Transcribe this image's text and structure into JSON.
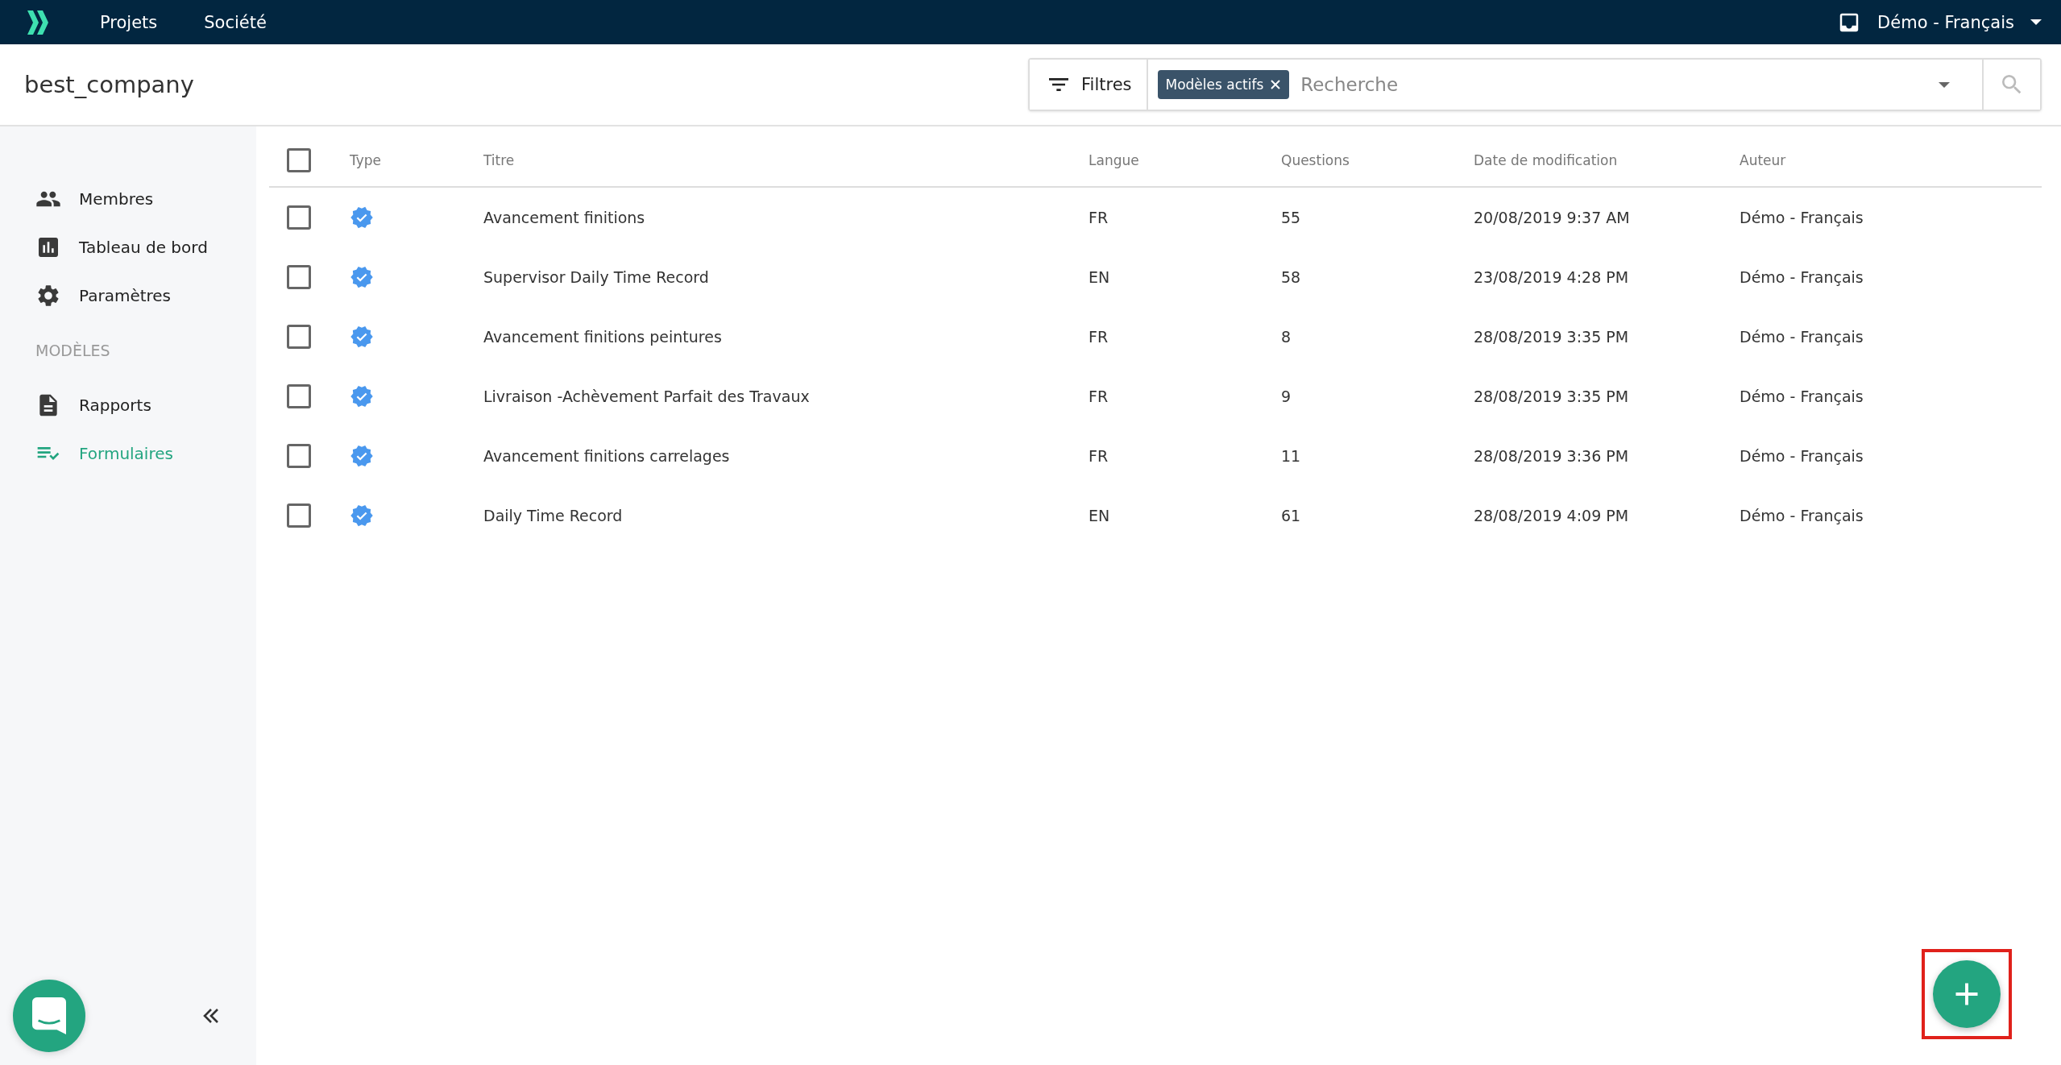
{
  "topbar": {
    "nav": [
      {
        "label": "Projets"
      },
      {
        "label": "Société"
      }
    ],
    "user": {
      "name": "Démo - Français"
    }
  },
  "header": {
    "title": "best_company",
    "filter_button": "Filtres",
    "chips": [
      {
        "label": "Modèles actifs"
      }
    ],
    "search": {
      "placeholder": "Recherche"
    }
  },
  "sidebar": {
    "items": [
      {
        "label": "Membres",
        "kind": "people",
        "selected": false
      },
      {
        "label": "Tableau de bord",
        "kind": "chart",
        "selected": false
      },
      {
        "label": "Paramètres",
        "kind": "gear",
        "selected": false
      }
    ],
    "section": "MODÈLES",
    "section_items": [
      {
        "label": "Rapports",
        "kind": "doc",
        "selected": false
      },
      {
        "label": "Formulaires",
        "kind": "checklist",
        "selected": true
      }
    ]
  },
  "table": {
    "select_all": {
      "checked": false
    },
    "columns": [
      "Type",
      "Titre",
      "Langue",
      "Questions",
      "Date de modification",
      "Auteur"
    ],
    "rows": [
      {
        "checked": false,
        "verified": true,
        "title": "Avancement finitions",
        "lang": "FR",
        "questions": "55",
        "date": "20/08/2019 9:37 AM",
        "author": "Démo - Français"
      },
      {
        "checked": false,
        "verified": true,
        "title": "Supervisor Daily Time Record",
        "lang": "EN",
        "questions": "58",
        "date": "23/08/2019 4:28 PM",
        "author": "Démo - Français"
      },
      {
        "checked": false,
        "verified": true,
        "title": "Avancement finitions peintures",
        "lang": "FR",
        "questions": "8",
        "date": "28/08/2019 3:35 PM",
        "author": "Démo - Français"
      },
      {
        "checked": false,
        "verified": true,
        "title": "Livraison -Achèvement Parfait des Travaux",
        "lang": "FR",
        "questions": "9",
        "date": "28/08/2019 3:35 PM",
        "author": "Démo - Français"
      },
      {
        "checked": false,
        "verified": true,
        "title": "Avancement finitions carrelages",
        "lang": "FR",
        "questions": "11",
        "date": "28/08/2019 3:36 PM",
        "author": "Démo - Français"
      },
      {
        "checked": false,
        "verified": true,
        "title": "Daily Time Record",
        "lang": "EN",
        "questions": "61",
        "date": "28/08/2019 4:09 PM",
        "author": "Démo - Français"
      }
    ]
  },
  "fab": {
    "highlighted": true
  }
}
